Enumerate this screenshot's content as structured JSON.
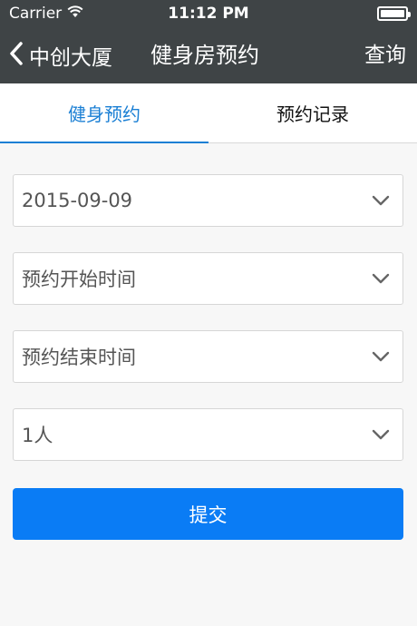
{
  "status_bar": {
    "carrier": "Carrier",
    "time": "11:12 PM"
  },
  "nav": {
    "back_label": "中创大厦",
    "title": "健身房预约",
    "action": "查询"
  },
  "tabs": [
    {
      "label": "健身预约",
      "active": true
    },
    {
      "label": "预约记录",
      "active": false
    }
  ],
  "form": {
    "date": "2015-09-09",
    "start_time": "预约开始时间",
    "end_time": "预约结束时间",
    "people": "1人"
  },
  "submit_label": "提交",
  "colors": {
    "nav_bg": "#3f4446",
    "accent": "#1a7fd4",
    "button": "#0a7cf5"
  }
}
